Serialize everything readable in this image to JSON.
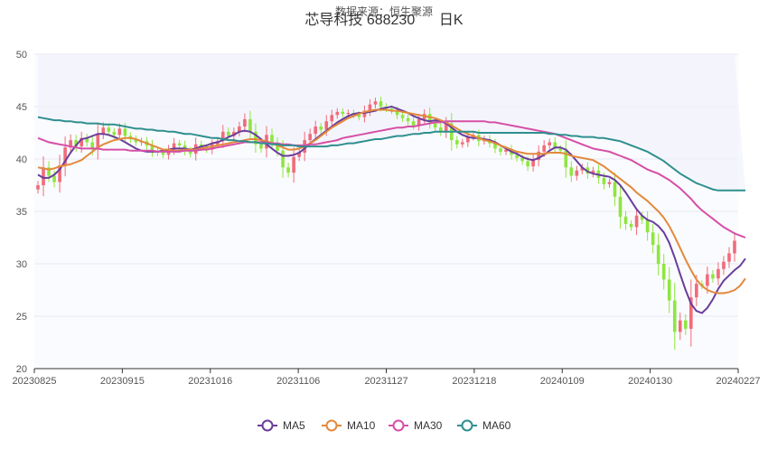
{
  "chart_data": {
    "type": "candlestick",
    "title": "芯导科技 688230",
    "title_suffix": "日K",
    "subtitle": "数据来源：恒生聚源",
    "ylim": [
      20,
      50
    ],
    "yticks": [
      20,
      25,
      30,
      35,
      40,
      45,
      50
    ],
    "xticks": [
      "20230825",
      "20230915",
      "20231016",
      "20231106",
      "20231127",
      "20231218",
      "20240109",
      "20240130",
      "20240227"
    ],
    "grid": true,
    "legend_position": "bottom",
    "colors": {
      "up": "#f16b7a",
      "down": "#8ee63f",
      "MA5": "#6a3d9a",
      "MA10": "#e3893b",
      "MA30": "#d64fa6",
      "MA60": "#2f8f8f",
      "band": "#eef1fa"
    },
    "candles_close": [
      37.5,
      39.2,
      38.4,
      37.8,
      39.4,
      41.1,
      41.8,
      41.2,
      42.0,
      41.6,
      40.9,
      42.4,
      43.0,
      42.6,
      42.3,
      42.9,
      42.2,
      41.9,
      41.6,
      41.7,
      41.3,
      40.7,
      40.6,
      40.4,
      40.9,
      41.5,
      41.3,
      40.8,
      40.5,
      41.4,
      41.1,
      40.9,
      41.4,
      41.7,
      42.6,
      42.2,
      42.6,
      43.1,
      43.8,
      42.6,
      41.4,
      41.0,
      42.3,
      41.5,
      40.8,
      39.2,
      38.7,
      40.2,
      40.6,
      41.8,
      42.4,
      43.1,
      42.8,
      43.6,
      44.2,
      44.5,
      44.3,
      44.4,
      44.2,
      44.0,
      44.6,
      45.2,
      45.5,
      45.0,
      44.8,
      44.6,
      44.2,
      43.9,
      43.6,
      43.2,
      43.8,
      44.3,
      43.5,
      43.0,
      42.6,
      43.4,
      41.8,
      41.4,
      41.6,
      42.1,
      42.3,
      41.7,
      41.9,
      41.5,
      41.0,
      40.7,
      40.9,
      40.4,
      40.1,
      39.8,
      39.3,
      39.9,
      40.7,
      41.3,
      41.6,
      41.0,
      40.8,
      39.2,
      38.4,
      38.9,
      39.2,
      38.6,
      38.9,
      38.2,
      37.6,
      37.8,
      36.4,
      34.5,
      33.8,
      33.5,
      34.6,
      34.2,
      33.0,
      31.8,
      30.0,
      28.5,
      26.5,
      23.5,
      24.6,
      23.8,
      26.8,
      28.1,
      27.9,
      29.0,
      28.6,
      29.5,
      30.2,
      31.0,
      32.2
    ],
    "series": [
      {
        "name": "MA5",
        "values": [
          38.5,
          38.2,
          38.2,
          38.5,
          39.0,
          39.8,
          40.6,
          41.3,
          41.9,
          42.0,
          42.2,
          42.4,
          42.4,
          42.3,
          42.1,
          41.9,
          41.6,
          41.3,
          41.0,
          40.8,
          40.7,
          40.7,
          40.7,
          40.8,
          40.9,
          41.0,
          41.0,
          41.0,
          40.9,
          41.0,
          41.2,
          41.3,
          41.5,
          41.6,
          41.8,
          42.1,
          42.3,
          42.6,
          42.7,
          42.6,
          42.3,
          41.9,
          41.4,
          41.0,
          40.6,
          40.3,
          40.3,
          40.4,
          40.6,
          41.0,
          41.5,
          41.9,
          42.3,
          42.7,
          43.1,
          43.5,
          43.8,
          44.1,
          44.3,
          44.4,
          44.4,
          44.5,
          44.6,
          44.8,
          44.9,
          45.0,
          44.8,
          44.6,
          44.4,
          44.1,
          43.9,
          43.7,
          43.6,
          43.7,
          43.6,
          43.4,
          43.0,
          42.6,
          42.3,
          42.1,
          42.0,
          42.0,
          41.9,
          41.8,
          41.6,
          41.3,
          41.0,
          40.7,
          40.5,
          40.2,
          40.0,
          39.9,
          40.1,
          40.4,
          40.8,
          41.1,
          41.1,
          40.9,
          40.4,
          39.8,
          39.2,
          38.8,
          38.6,
          38.5,
          38.4,
          38.3,
          38.0,
          37.5,
          36.8,
          36.0,
          35.2,
          34.6,
          34.2,
          34.0,
          33.6,
          33.0,
          32.0,
          30.6,
          29.0,
          27.5,
          26.2,
          25.5,
          25.3,
          25.8,
          26.6,
          27.6,
          28.4,
          28.9,
          29.4,
          29.8,
          30.5
        ]
      },
      {
        "name": "MA10",
        "values": [
          39.2,
          39.1,
          39.0,
          39.1,
          39.3,
          39.4,
          39.5,
          39.7,
          39.9,
          40.3,
          40.7,
          41.1,
          41.4,
          41.6,
          41.8,
          41.9,
          42.0,
          42.0,
          41.9,
          41.7,
          41.5,
          41.3,
          41.1,
          40.9,
          40.9,
          40.8,
          40.8,
          40.9,
          40.9,
          40.9,
          41.0,
          41.1,
          41.2,
          41.3,
          41.4,
          41.5,
          41.6,
          41.7,
          41.8,
          41.9,
          41.9,
          41.8,
          41.7,
          41.5,
          41.3,
          41.1,
          40.9,
          40.9,
          41.0,
          41.2,
          41.5,
          41.8,
          42.2,
          42.6,
          43.0,
          43.3,
          43.6,
          43.9,
          44.1,
          44.3,
          44.5,
          44.6,
          44.7,
          44.7,
          44.7,
          44.6,
          44.6,
          44.5,
          44.4,
          44.3,
          44.2,
          44.1,
          44.0,
          43.9,
          43.7,
          43.5,
          43.2,
          42.9,
          42.6,
          42.4,
          42.2,
          42.0,
          41.8,
          41.7,
          41.5,
          41.3,
          41.1,
          40.9,
          40.7,
          40.6,
          40.5,
          40.5,
          40.5,
          40.5,
          40.6,
          40.6,
          40.6,
          40.5,
          40.3,
          40.2,
          40.1,
          40.0,
          39.9,
          39.6,
          39.3,
          38.9,
          38.5,
          38.1,
          37.7,
          37.3,
          36.8,
          36.4,
          36.0,
          35.5,
          35.0,
          34.4,
          33.6,
          32.6,
          31.5,
          30.4,
          29.4,
          28.5,
          27.9,
          27.5,
          27.3,
          27.2,
          27.2,
          27.3,
          27.5,
          27.9,
          28.6
        ]
      },
      {
        "name": "MA30",
        "values": [
          42.0,
          41.8,
          41.6,
          41.5,
          41.4,
          41.3,
          41.2,
          41.1,
          41.0,
          41.0,
          41.0,
          41.0,
          40.9,
          40.9,
          40.9,
          40.9,
          40.9,
          40.8,
          40.8,
          40.8,
          40.8,
          40.8,
          40.7,
          40.7,
          40.7,
          40.7,
          40.7,
          40.8,
          40.8,
          40.8,
          40.9,
          40.9,
          41.0,
          41.1,
          41.2,
          41.3,
          41.4,
          41.5,
          41.6,
          41.6,
          41.6,
          41.6,
          41.6,
          41.5,
          41.5,
          41.4,
          41.4,
          41.3,
          41.3,
          41.3,
          41.4,
          41.4,
          41.5,
          41.6,
          41.7,
          41.8,
          42.0,
          42.1,
          42.2,
          42.3,
          42.4,
          42.5,
          42.6,
          42.7,
          42.8,
          42.9,
          43.0,
          43.0,
          43.1,
          43.1,
          43.2,
          43.3,
          43.4,
          43.5,
          43.5,
          43.6,
          43.6,
          43.6,
          43.6,
          43.6,
          43.6,
          43.6,
          43.6,
          43.5,
          43.5,
          43.4,
          43.3,
          43.2,
          43.1,
          43.0,
          42.9,
          42.8,
          42.7,
          42.6,
          42.5,
          42.4,
          42.2,
          42.0,
          41.8,
          41.6,
          41.4,
          41.2,
          41.0,
          40.9,
          40.8,
          40.7,
          40.5,
          40.3,
          40.1,
          39.9,
          39.6,
          39.3,
          39.0,
          38.8,
          38.6,
          38.3,
          38.0,
          37.6,
          37.2,
          36.7,
          36.2,
          35.6,
          35.1,
          34.7,
          34.3,
          33.9,
          33.5,
          33.2,
          32.9,
          32.7,
          32.5
        ]
      },
      {
        "name": "MA60",
        "values": [
          44.0,
          43.9,
          43.8,
          43.7,
          43.7,
          43.6,
          43.6,
          43.5,
          43.5,
          43.4,
          43.4,
          43.4,
          43.3,
          43.3,
          43.3,
          43.2,
          43.1,
          43.0,
          42.9,
          42.9,
          42.8,
          42.8,
          42.7,
          42.7,
          42.6,
          42.6,
          42.5,
          42.4,
          42.4,
          42.3,
          42.2,
          42.1,
          42.0,
          42.0,
          41.9,
          41.8,
          41.8,
          41.7,
          41.7,
          41.6,
          41.6,
          41.5,
          41.5,
          41.4,
          41.4,
          41.3,
          41.3,
          41.3,
          41.2,
          41.2,
          41.2,
          41.2,
          41.2,
          41.2,
          41.3,
          41.3,
          41.4,
          41.5,
          41.5,
          41.6,
          41.7,
          41.8,
          41.9,
          41.9,
          42.0,
          42.1,
          42.2,
          42.2,
          42.3,
          42.4,
          42.4,
          42.5,
          42.5,
          42.6,
          42.6,
          42.6,
          42.6,
          42.6,
          42.6,
          42.6,
          42.6,
          42.5,
          42.5,
          42.5,
          42.5,
          42.5,
          42.5,
          42.5,
          42.5,
          42.5,
          42.5,
          42.5,
          42.5,
          42.5,
          42.4,
          42.4,
          42.3,
          42.3,
          42.2,
          42.2,
          42.1,
          42.1,
          42.1,
          42.0,
          42.0,
          41.9,
          41.8,
          41.7,
          41.5,
          41.3,
          41.1,
          40.9,
          40.7,
          40.4,
          40.1,
          39.8,
          39.4,
          39.0,
          38.6,
          38.3,
          38.0,
          37.7,
          37.5,
          37.3,
          37.1,
          37.0,
          37.0,
          37.0,
          37.0,
          37.0,
          37.0
        ]
      }
    ]
  }
}
